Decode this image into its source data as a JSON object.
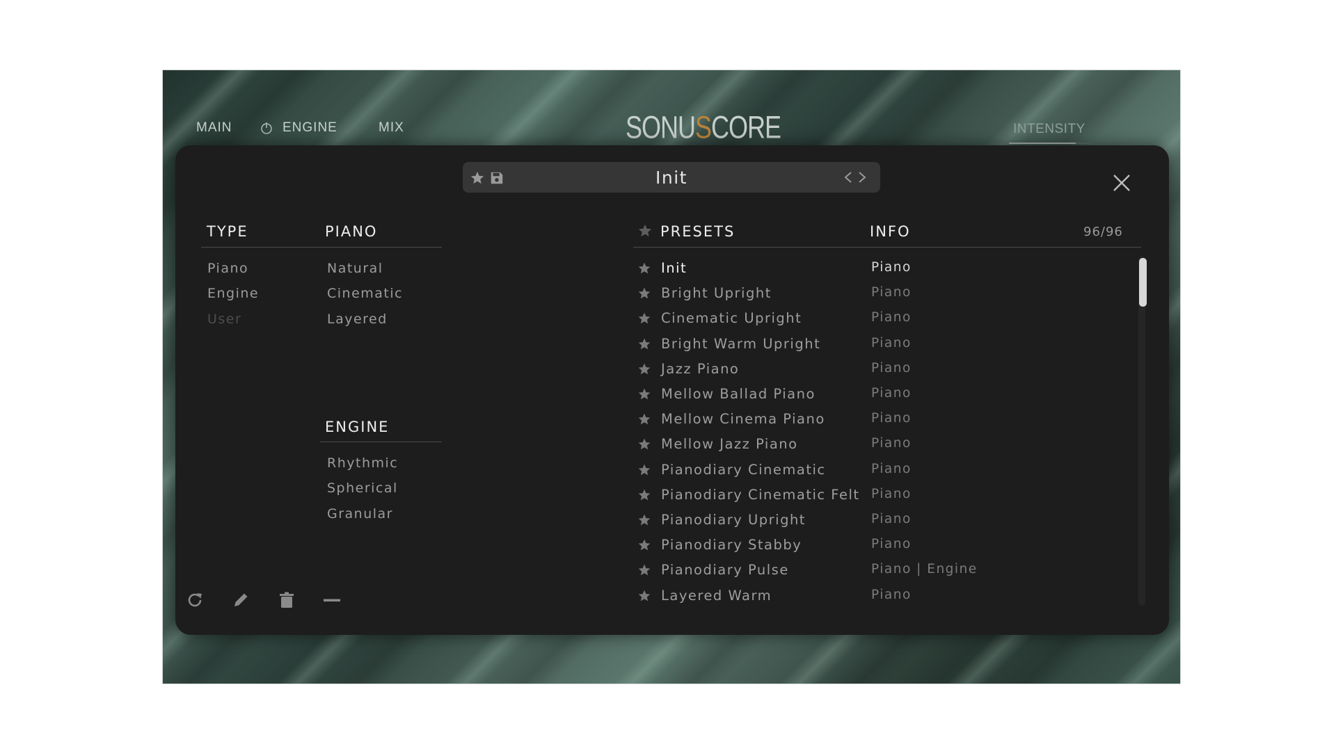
{
  "nav": {
    "main": "MAIN",
    "engine": "ENGINE",
    "mix": "MIX",
    "intensity": "INTENSITY"
  },
  "logo": {
    "text_a": "SONU",
    "text_s": "S",
    "text_b": "CORE"
  },
  "preset_bar": {
    "name": "Init",
    "icons": [
      "star-icon",
      "save-icon",
      "chevron-left-icon",
      "chevron-right-icon"
    ]
  },
  "close_icon": "close-icon",
  "columns": {
    "type": "TYPE",
    "piano": "PIANO",
    "engine": "ENGINE",
    "presets": "PRESETS",
    "info": "INFO"
  },
  "type_items": [
    "Piano",
    "Engine",
    "User"
  ],
  "piano_items": [
    "Natural",
    "Cinematic",
    "Layered"
  ],
  "engine_items": [
    "Rhythmic",
    "Spherical",
    "Granular"
  ],
  "counter": "96/96",
  "presets": [
    {
      "name": "Init",
      "info": "Piano"
    },
    {
      "name": "Bright Upright",
      "info": "Piano"
    },
    {
      "name": "Cinematic Upright",
      "info": "Piano"
    },
    {
      "name": "Bright Warm Upright",
      "info": "Piano"
    },
    {
      "name": "Jazz Piano",
      "info": "Piano"
    },
    {
      "name": "Mellow Ballad Piano",
      "info": "Piano"
    },
    {
      "name": "Mellow Cinema Piano",
      "info": "Piano"
    },
    {
      "name": "Mellow Jazz Piano",
      "info": "Piano"
    },
    {
      "name": "Pianodiary Cinematic",
      "info": "Piano"
    },
    {
      "name": "Pianodiary Cinematic Felt",
      "info": "Piano"
    },
    {
      "name": "Pianodiary Upright",
      "info": "Piano"
    },
    {
      "name": "Pianodiary Stabby",
      "info": "Piano"
    },
    {
      "name": "Pianodiary Pulse",
      "info": "Piano | Engine"
    },
    {
      "name": "Layered Warm",
      "info": "Piano"
    }
  ],
  "tools": [
    "refresh-icon",
    "pencil-icon",
    "trash-icon",
    "minus-icon"
  ],
  "colors": {
    "panel": "#1d1d1d",
    "accent_logo": "#b8823c"
  }
}
